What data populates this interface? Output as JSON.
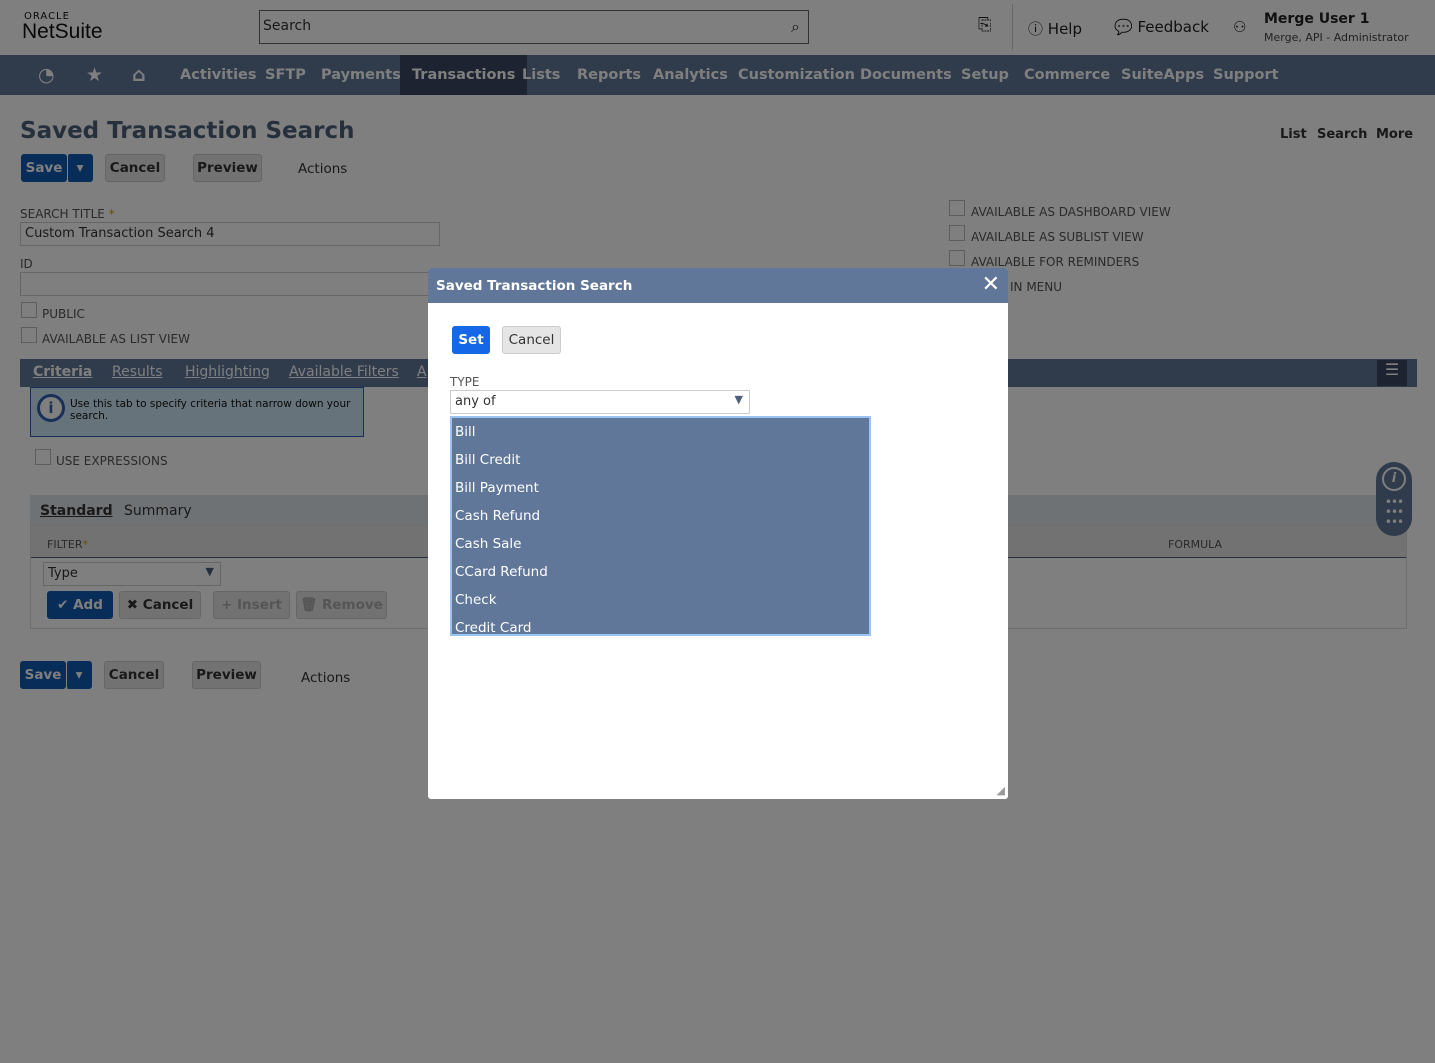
{
  "header": {
    "logo_top": "ORACLE",
    "logo_main": "NetSuite",
    "search_placeholder": "Search",
    "help": "Help",
    "feedback": "Feedback",
    "user_name": "Merge User 1",
    "user_role": "Merge, API - Administrator"
  },
  "nav": {
    "items": [
      "Activities",
      "SFTP",
      "Payments",
      "Transactions",
      "Lists",
      "Reports",
      "Analytics",
      "Customization",
      "Documents",
      "Setup",
      "Commerce",
      "SuiteApps",
      "Support"
    ],
    "active": "Transactions"
  },
  "page": {
    "title": "Saved Transaction Search",
    "links": [
      "List",
      "Search",
      "More"
    ],
    "buttons": {
      "save": "Save",
      "cancel": "Cancel",
      "preview": "Preview",
      "actions": "Actions"
    },
    "search_title_label": "SEARCH TITLE",
    "search_title_value": "Custom Transaction Search 4",
    "id_label": "ID",
    "checkboxes_left": [
      "PUBLIC",
      "AVAILABLE AS LIST VIEW"
    ],
    "checkboxes_right": [
      "AVAILABLE AS DASHBOARD VIEW",
      "AVAILABLE AS SUBLIST VIEW",
      "AVAILABLE FOR REMINDERS",
      "IN MENU"
    ],
    "tabs": [
      "Criteria",
      "Results",
      "Highlighting",
      "Available Filters",
      "A"
    ],
    "info_text": "Use this tab to specify criteria that narrow down your search.",
    "use_expressions": "USE EXPRESSIONS",
    "subtabs": [
      "Standard",
      "Summary"
    ],
    "filter_header": "FILTER",
    "formula_header": "FORMULA",
    "filter_value": "Type",
    "row_buttons": {
      "add": "Add",
      "cancel": "Cancel",
      "insert": "Insert",
      "remove": "Remove"
    }
  },
  "modal": {
    "title": "Saved Transaction Search",
    "set": "Set",
    "cancel": "Cancel",
    "type_label": "TYPE",
    "type_value": "any of",
    "options": [
      "Bill",
      "Bill Credit",
      "Bill Payment",
      "Cash Refund",
      "Cash Sale",
      "CCard Refund",
      "Check",
      "Credit Card"
    ]
  },
  "colors": {
    "nav": "#607799",
    "primary": "#125ab2",
    "overlay": "rgba(0,0,0,0.5)"
  }
}
